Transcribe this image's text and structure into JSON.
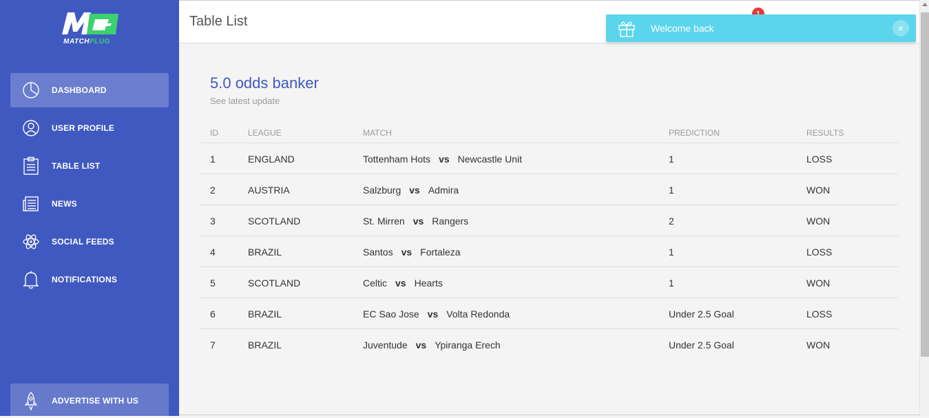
{
  "brand": {
    "logo_text_1": "MATCH",
    "logo_text_2": "PLUG",
    "logo_colors": {
      "white": "#ffffff",
      "green": "#3bd16f"
    }
  },
  "sidebar": {
    "items": [
      {
        "label": "DASHBOARD",
        "icon": "pie-chart-icon",
        "active": true
      },
      {
        "label": "USER PROFILE",
        "icon": "user-icon",
        "active": false
      },
      {
        "label": "TABLE LIST",
        "icon": "clipboard-icon",
        "active": false
      },
      {
        "label": "NEWS",
        "icon": "newspaper-icon",
        "active": false
      },
      {
        "label": "SOCIAL FEEDS",
        "icon": "atom-icon",
        "active": false
      },
      {
        "label": "NOTIFICATIONS",
        "icon": "bell-icon",
        "active": false
      }
    ],
    "advertise": {
      "label": "ADVERTISE WITH US",
      "icon": "rocket-icon"
    }
  },
  "header": {
    "title": "Table List",
    "notification_count": "1"
  },
  "toast": {
    "message": "Welcome back",
    "close": "×",
    "icon": "gift-icon"
  },
  "card": {
    "title": "5.0 odds banker",
    "subtitle": "See latest update"
  },
  "table": {
    "columns": [
      "ID",
      "LEAGUE",
      "MATCH",
      "PREDICTION",
      "RESULTS"
    ],
    "vs_label": "vs",
    "rows": [
      {
        "id": "1",
        "league": "ENGLAND",
        "home": "Tottenham Hots",
        "away": "Newcastle Unit",
        "prediction": "1",
        "result": "LOSS"
      },
      {
        "id": "2",
        "league": "AUSTRIA",
        "home": "Salzburg",
        "away": "Admira",
        "prediction": "1",
        "result": "WON"
      },
      {
        "id": "3",
        "league": "SCOTLAND",
        "home": "St. Mirren",
        "away": "Rangers",
        "prediction": "2",
        "result": "WON"
      },
      {
        "id": "4",
        "league": "BRAZIL",
        "home": "Santos",
        "away": "Fortaleza",
        "prediction": "1",
        "result": "LOSS"
      },
      {
        "id": "5",
        "league": "SCOTLAND",
        "home": "Celtic",
        "away": "Hearts",
        "prediction": "1",
        "result": "WON"
      },
      {
        "id": "6",
        "league": "BRAZIL",
        "home": "EC Sao Jose",
        "away": "Volta Redonda",
        "prediction": "Under 2.5 Goal",
        "result": "LOSS"
      },
      {
        "id": "7",
        "league": "BRAZIL",
        "home": "Juventude",
        "away": "Ypiranga Erech",
        "prediction": "Under 2.5 Goal",
        "result": "WON"
      }
    ]
  },
  "colors": {
    "sidebar": "#4059c0",
    "accent": "#4059c0",
    "toast": "#5bd5eb",
    "badge": "#e53935"
  }
}
